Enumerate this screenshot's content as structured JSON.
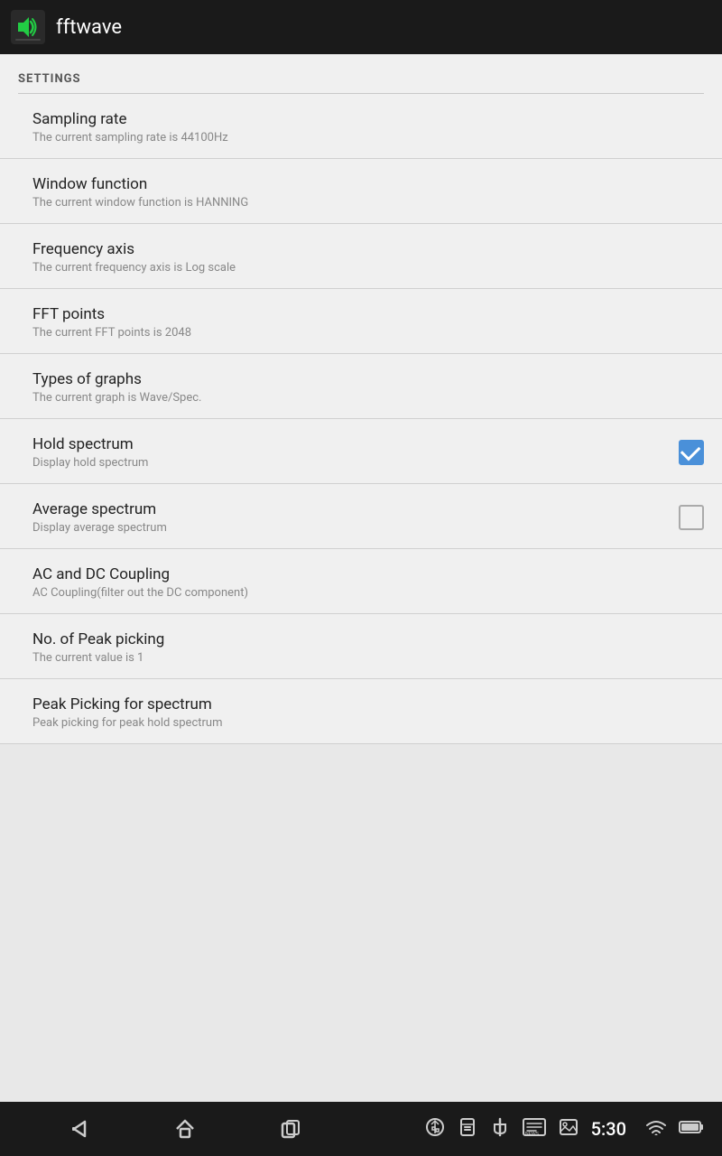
{
  "appBar": {
    "title": "fftwave"
  },
  "settings": {
    "sectionLabel": "SETTINGS",
    "items": [
      {
        "id": "sampling-rate",
        "title": "Sampling rate",
        "subtitle": "The current sampling rate is 44100Hz",
        "hasCheckbox": false
      },
      {
        "id": "window-function",
        "title": "Window function",
        "subtitle": "The current window function is HANNING",
        "hasCheckbox": false
      },
      {
        "id": "frequency-axis",
        "title": "Frequency axis",
        "subtitle": "The current frequency axis is Log scale",
        "hasCheckbox": false
      },
      {
        "id": "fft-points",
        "title": "FFT points",
        "subtitle": "The current FFT points is 2048",
        "hasCheckbox": false
      },
      {
        "id": "types-of-graphs",
        "title": "Types of graphs",
        "subtitle": "The current graph is Wave/Spec.",
        "hasCheckbox": false
      },
      {
        "id": "hold-spectrum",
        "title": "Hold spectrum",
        "subtitle": "Display hold spectrum",
        "hasCheckbox": true,
        "checked": true
      },
      {
        "id": "average-spectrum",
        "title": "Average spectrum",
        "subtitle": "Display average spectrum",
        "hasCheckbox": true,
        "checked": false
      },
      {
        "id": "ac-dc-coupling",
        "title": "AC and DC Coupling",
        "subtitle": "AC Coupling(filter out the DC component)",
        "hasCheckbox": false
      },
      {
        "id": "peak-picking",
        "title": "No. of Peak picking",
        "subtitle": "The current value is 1",
        "hasCheckbox": false
      },
      {
        "id": "peak-picking-spectrum",
        "title": "Peak Picking for spectrum",
        "subtitle": "Peak picking for peak hold spectrum",
        "hasCheckbox": false
      }
    ]
  },
  "navBar": {
    "time": "5:30",
    "backLabel": "back",
    "homeLabel": "home",
    "recentLabel": "recent"
  }
}
